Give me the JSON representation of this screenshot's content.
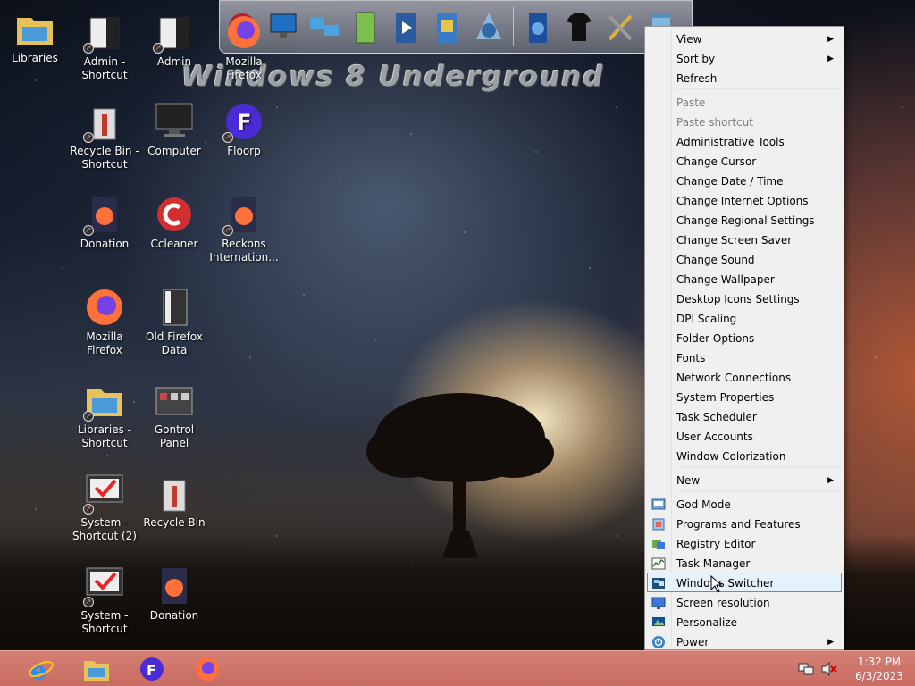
{
  "desktop": {
    "watermark": "Windows 8 Underground",
    "icons": [
      {
        "label": "Libraries"
      },
      {
        "label": "Admin - Shortcut"
      },
      {
        "label": "Admin"
      },
      {
        "label": "Mozilla Firefox"
      },
      {
        "label": "Recycle Bin - Shortcut"
      },
      {
        "label": "Computer"
      },
      {
        "label": "Floorp"
      },
      {
        "label": "Donation"
      },
      {
        "label": "Ccleaner"
      },
      {
        "label": "Reckons Internation..."
      },
      {
        "label": "Mozilla Firefox"
      },
      {
        "label": "Old Firefox Data"
      },
      {
        "label": "Libraries - Shortcut"
      },
      {
        "label": "Gontrol Panel"
      },
      {
        "label": "System - Shortcut (2)"
      },
      {
        "label": "Recycle Bin"
      },
      {
        "label": "System - Shortcut"
      },
      {
        "label": "Donation"
      }
    ]
  },
  "context_menu": {
    "items": [
      {
        "label": "View"
      },
      {
        "label": "Sort by"
      },
      {
        "label": "Refresh"
      },
      {
        "label": "Paste"
      },
      {
        "label": "Paste shortcut"
      },
      {
        "label": "Administrative Tools"
      },
      {
        "label": "Change Cursor"
      },
      {
        "label": "Change Date / Time"
      },
      {
        "label": "Change Internet Options"
      },
      {
        "label": "Change Regional Settings"
      },
      {
        "label": "Change Screen Saver"
      },
      {
        "label": "Change Sound"
      },
      {
        "label": "Change Wallpaper"
      },
      {
        "label": "Desktop Icons Settings"
      },
      {
        "label": "DPI Scaling"
      },
      {
        "label": "Folder Options"
      },
      {
        "label": "Fonts"
      },
      {
        "label": "Network Connections"
      },
      {
        "label": "System Properties"
      },
      {
        "label": "Task Scheduler"
      },
      {
        "label": "User Accounts"
      },
      {
        "label": "Window Colorization"
      },
      {
        "label": "New"
      },
      {
        "label": "God Mode"
      },
      {
        "label": "Programs and Features"
      },
      {
        "label": "Registry Editor"
      },
      {
        "label": "Task Manager"
      },
      {
        "label": "Windows Switcher"
      },
      {
        "label": "Screen resolution"
      },
      {
        "label": "Personalize"
      },
      {
        "label": "Power"
      }
    ],
    "submenu_arrow": "▶"
  },
  "taskbar": {
    "time": "1:32 PM",
    "date": "6/3/2023"
  },
  "colors": {
    "taskbar": "#c96c62",
    "menu_bg": "#f0f0f0",
    "highlight_border": "#3399ff",
    "highlight_bg": "#e5f1fb",
    "disabled_text": "#7f7f7f"
  },
  "icon_names": [
    "folder-icon",
    "admin-icon",
    "firefox-icon",
    "recycle-bin-icon",
    "computer-icon",
    "floorp-icon",
    "ccleaner-icon",
    "document-icon",
    "control-panel-icon",
    "system-icon",
    "ie-icon",
    "explorer-icon",
    "network-tray-icon",
    "volume-muted-icon"
  ]
}
